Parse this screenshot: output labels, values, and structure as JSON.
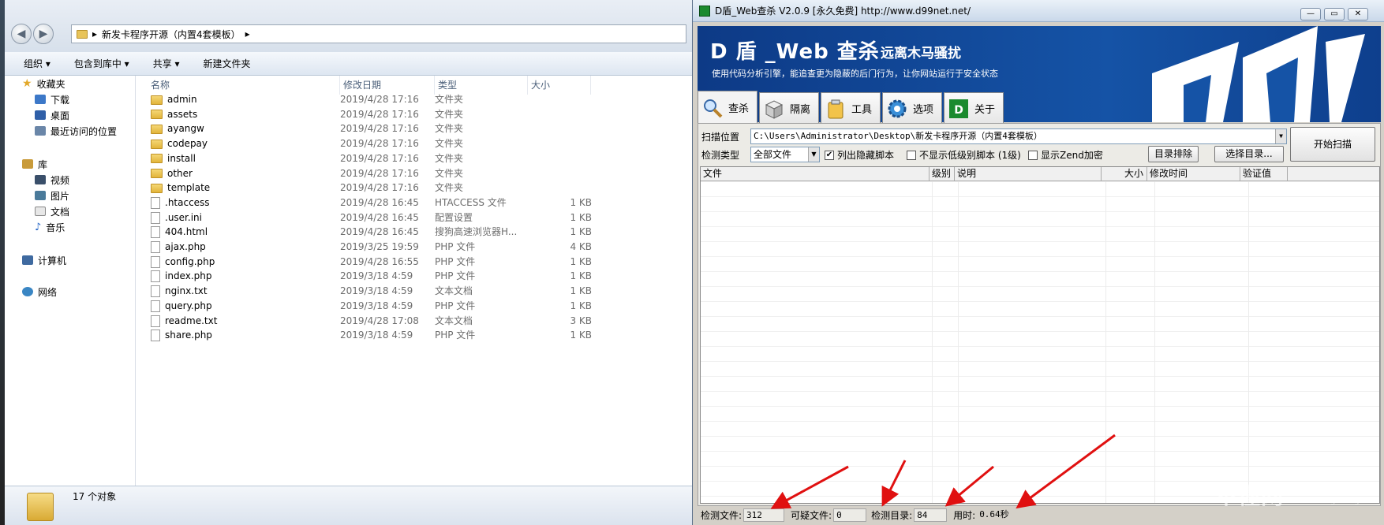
{
  "explorer": {
    "address": [
      "新发卡程序开源（内置4套模板）"
    ],
    "commands": [
      "组织 ▾",
      "包含到库中 ▾",
      "共享 ▾",
      "新建文件夹"
    ],
    "nav": {
      "favorites_label": "收藏夹",
      "favorites": [
        "下载",
        "桌面",
        "最近访问的位置"
      ],
      "libraries_label": "库",
      "libraries": [
        "视频",
        "图片",
        "文档",
        "音乐"
      ],
      "computer": "计算机",
      "network": "网络"
    },
    "columns": [
      "名称",
      "修改日期",
      "类型",
      "大小"
    ],
    "files": [
      {
        "name": "admin",
        "date": "2019/4/28 17:16",
        "type": "文件夹",
        "size": "",
        "kind": "folder"
      },
      {
        "name": "assets",
        "date": "2019/4/28 17:16",
        "type": "文件夹",
        "size": "",
        "kind": "folder"
      },
      {
        "name": "ayangw",
        "date": "2019/4/28 17:16",
        "type": "文件夹",
        "size": "",
        "kind": "folder"
      },
      {
        "name": "codepay",
        "date": "2019/4/28 17:16",
        "type": "文件夹",
        "size": "",
        "kind": "folder"
      },
      {
        "name": "install",
        "date": "2019/4/28 17:16",
        "type": "文件夹",
        "size": "",
        "kind": "folder"
      },
      {
        "name": "other",
        "date": "2019/4/28 17:16",
        "type": "文件夹",
        "size": "",
        "kind": "folder"
      },
      {
        "name": "template",
        "date": "2019/4/28 17:16",
        "type": "文件夹",
        "size": "",
        "kind": "folder"
      },
      {
        "name": ".htaccess",
        "date": "2019/4/28 16:45",
        "type": "HTACCESS 文件",
        "size": "1 KB",
        "kind": "file"
      },
      {
        "name": ".user.ini",
        "date": "2019/4/28 16:45",
        "type": "配置设置",
        "size": "1 KB",
        "kind": "config"
      },
      {
        "name": "404.html",
        "date": "2019/4/28 16:45",
        "type": "搜狗高速浏览器H...",
        "size": "1 KB",
        "kind": "html"
      },
      {
        "name": "ajax.php",
        "date": "2019/3/25 19:59",
        "type": "PHP 文件",
        "size": "4 KB",
        "kind": "file"
      },
      {
        "name": "config.php",
        "date": "2019/4/28 16:55",
        "type": "PHP 文件",
        "size": "1 KB",
        "kind": "file"
      },
      {
        "name": "index.php",
        "date": "2019/3/18 4:59",
        "type": "PHP 文件",
        "size": "1 KB",
        "kind": "file"
      },
      {
        "name": "nginx.txt",
        "date": "2019/3/18 4:59",
        "type": "文本文档",
        "size": "1 KB",
        "kind": "file"
      },
      {
        "name": "query.php",
        "date": "2019/3/18 4:59",
        "type": "PHP 文件",
        "size": "1 KB",
        "kind": "file"
      },
      {
        "name": "readme.txt",
        "date": "2019/4/28 17:08",
        "type": "文本文档",
        "size": "3 KB",
        "kind": "file"
      },
      {
        "name": "share.php",
        "date": "2019/3/18 4:59",
        "type": "PHP 文件",
        "size": "1 KB",
        "kind": "file"
      }
    ],
    "status": "17 个对象"
  },
  "dshield": {
    "title": "D盾_Web查杀 V2.0.9 [永久免费] http://www.d99net.net/",
    "brand": "D 盾 _Web 查杀",
    "brand_sub": "远离木马骚扰",
    "slogan": "使用代码分析引擎，能追查更为隐蔽的后门行为，让你网站运行于安全状态",
    "tabs": [
      "查杀",
      "隔离",
      "工具",
      "选项",
      "关于"
    ],
    "scan_label": "扫描位置",
    "scan_path": "C:\\Users\\Administrator\\Desktop\\新发卡程序开源（内置4套模板）",
    "start_button": "开始扫描",
    "type_label": "检测类型",
    "type_value": "全部文件",
    "check_hidden": "列出隐藏脚本",
    "check_lowlevel": "不显示低级别脚本 (1级)",
    "check_zend": "显示Zend加密",
    "exclude_button": "目录排除",
    "choose_button": "选择目录...",
    "table_cols": [
      "文件",
      "级别",
      "说明",
      "大小",
      "修改时间",
      "验证值"
    ],
    "status": {
      "files_label": "检测文件:",
      "files": "312",
      "suspect_label": "可疑文件:",
      "suspect": "0",
      "dirs_label": "检测目录:",
      "dirs": "84",
      "time_label": "用时:",
      "time": "0.64秒"
    }
  },
  "watermark": {
    "main": "不懂网",
    "sub": "爱分享",
    "pinyin": "bu dong wang"
  },
  "colors": {
    "banner": "#1553a6",
    "arrow": "#e01010",
    "folder": "#e8c45a"
  }
}
